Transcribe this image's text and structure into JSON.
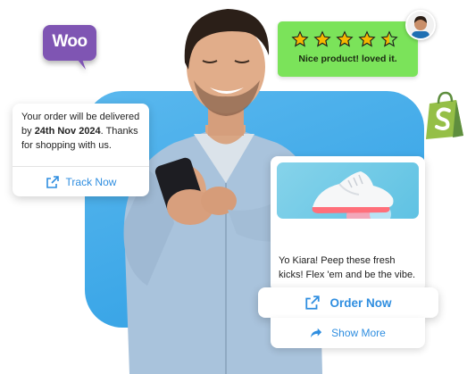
{
  "woo_badge": {
    "text": "Woo",
    "color": "#7f54b3"
  },
  "shopify": {
    "color": "#95bf47"
  },
  "rating_card": {
    "stars": 5,
    "rating": 4.5,
    "text": "Nice product! loved it.",
    "background": "#7be35a",
    "star_color": "#f5b800"
  },
  "order_card": {
    "text_before": "Your order will be delivered by ",
    "date": "24th Nov 2024",
    "text_after": ". Thanks for shopping with us.",
    "button_label": "Track Now",
    "button_icon": "external-link-icon"
  },
  "product_card": {
    "message": "Yo Kiara! Peep these fresh kicks! Flex 'em and be the vibe.",
    "image_icon": "sneaker-image"
  },
  "actions": {
    "order_now_label": "Order Now",
    "order_now_icon": "external-link-icon",
    "show_more_label": "Show More",
    "show_more_icon": "share-arrow-icon"
  },
  "colors": {
    "accent": "#2f8ee0",
    "backdrop": "#3ea8e8"
  }
}
